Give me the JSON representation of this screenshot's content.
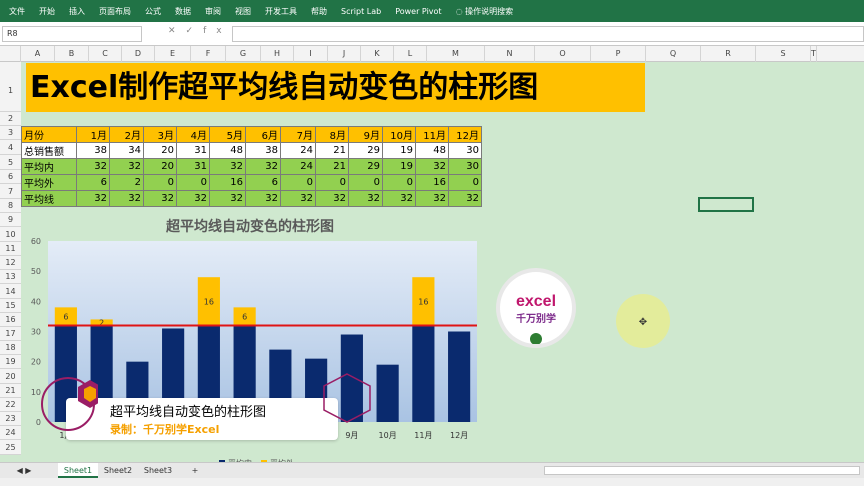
{
  "ribbon": {
    "tabs": [
      "文件",
      "开始",
      "插入",
      "页面布局",
      "公式",
      "数据",
      "审阅",
      "视图",
      "开发工具",
      "帮助",
      "Script Lab",
      "Power Pivot"
    ],
    "search": "操作说明搜索"
  },
  "namebox": "R8",
  "fx_label": "fx",
  "columns": [
    "A",
    "B",
    "C",
    "D",
    "E",
    "F",
    "G",
    "H",
    "I",
    "J",
    "K",
    "L",
    "M",
    "N",
    "O",
    "P",
    "Q",
    "R",
    "S",
    "T"
  ],
  "rows": [
    "1",
    "2",
    "3",
    "4",
    "5",
    "6",
    "7",
    "8",
    "9",
    "10",
    "11",
    "12",
    "13",
    "14",
    "15",
    "16",
    "17",
    "18",
    "19",
    "20",
    "21",
    "22",
    "23",
    "24",
    "25"
  ],
  "title": "Excel制作超平均线自动变色的柱形图",
  "table": {
    "months": [
      "1月",
      "2月",
      "3月",
      "4月",
      "5月",
      "6月",
      "7月",
      "8月",
      "9月",
      "10月",
      "11月",
      "12月"
    ],
    "rows": [
      {
        "label": "月份",
        "values": []
      },
      {
        "label": "总销售额",
        "values": [
          38,
          34,
          20,
          31,
          48,
          38,
          24,
          21,
          29,
          19,
          48,
          30
        ]
      },
      {
        "label": "平均内",
        "values": [
          32,
          32,
          20,
          31,
          32,
          32,
          24,
          21,
          29,
          19,
          32,
          30
        ]
      },
      {
        "label": "平均外",
        "values": [
          6,
          2,
          0,
          0,
          16,
          6,
          0,
          0,
          0,
          0,
          16,
          0
        ]
      },
      {
        "label": "平均线",
        "values": [
          32,
          32,
          32,
          32,
          32,
          32,
          32,
          32,
          32,
          32,
          32,
          32
        ]
      }
    ]
  },
  "chart_data": {
    "type": "bar",
    "title": "超平均线自动变色的柱形图",
    "categories": [
      "1月",
      "2月",
      "3月",
      "4月",
      "5月",
      "6月",
      "7月",
      "8月",
      "9月",
      "10月",
      "11月",
      "12月"
    ],
    "series": [
      {
        "name": "平均内",
        "values": [
          32,
          32,
          20,
          31,
          32,
          32,
          24,
          21,
          29,
          19,
          32,
          30
        ],
        "color": "#0a2a6e"
      },
      {
        "name": "平均外",
        "values": [
          6,
          2,
          0,
          0,
          16,
          6,
          0,
          0,
          0,
          0,
          16,
          0
        ],
        "color": "#ffc000"
      },
      {
        "name": "平均线",
        "values": [
          32,
          32,
          32,
          32,
          32,
          32,
          32,
          32,
          32,
          32,
          32,
          32
        ],
        "color": "#e01414"
      }
    ],
    "data_labels": [
      "6",
      "2",
      "",
      "",
      "16",
      "6",
      "",
      "",
      "",
      "",
      "16",
      ""
    ],
    "y_ticks": [
      "0",
      "10",
      "20",
      "30",
      "40",
      "50",
      "60"
    ],
    "ylim": [
      0,
      60
    ],
    "legend": "bottom"
  },
  "overlay": {
    "title": "超平均线自动变色的柱形图",
    "credit": "录制：千万别学Excel"
  },
  "logo": {
    "brand": "excel",
    "sub": "千万别学"
  },
  "sheets": [
    "Sheet1",
    "Sheet2",
    "Sheet3"
  ],
  "add_sheet": "+"
}
